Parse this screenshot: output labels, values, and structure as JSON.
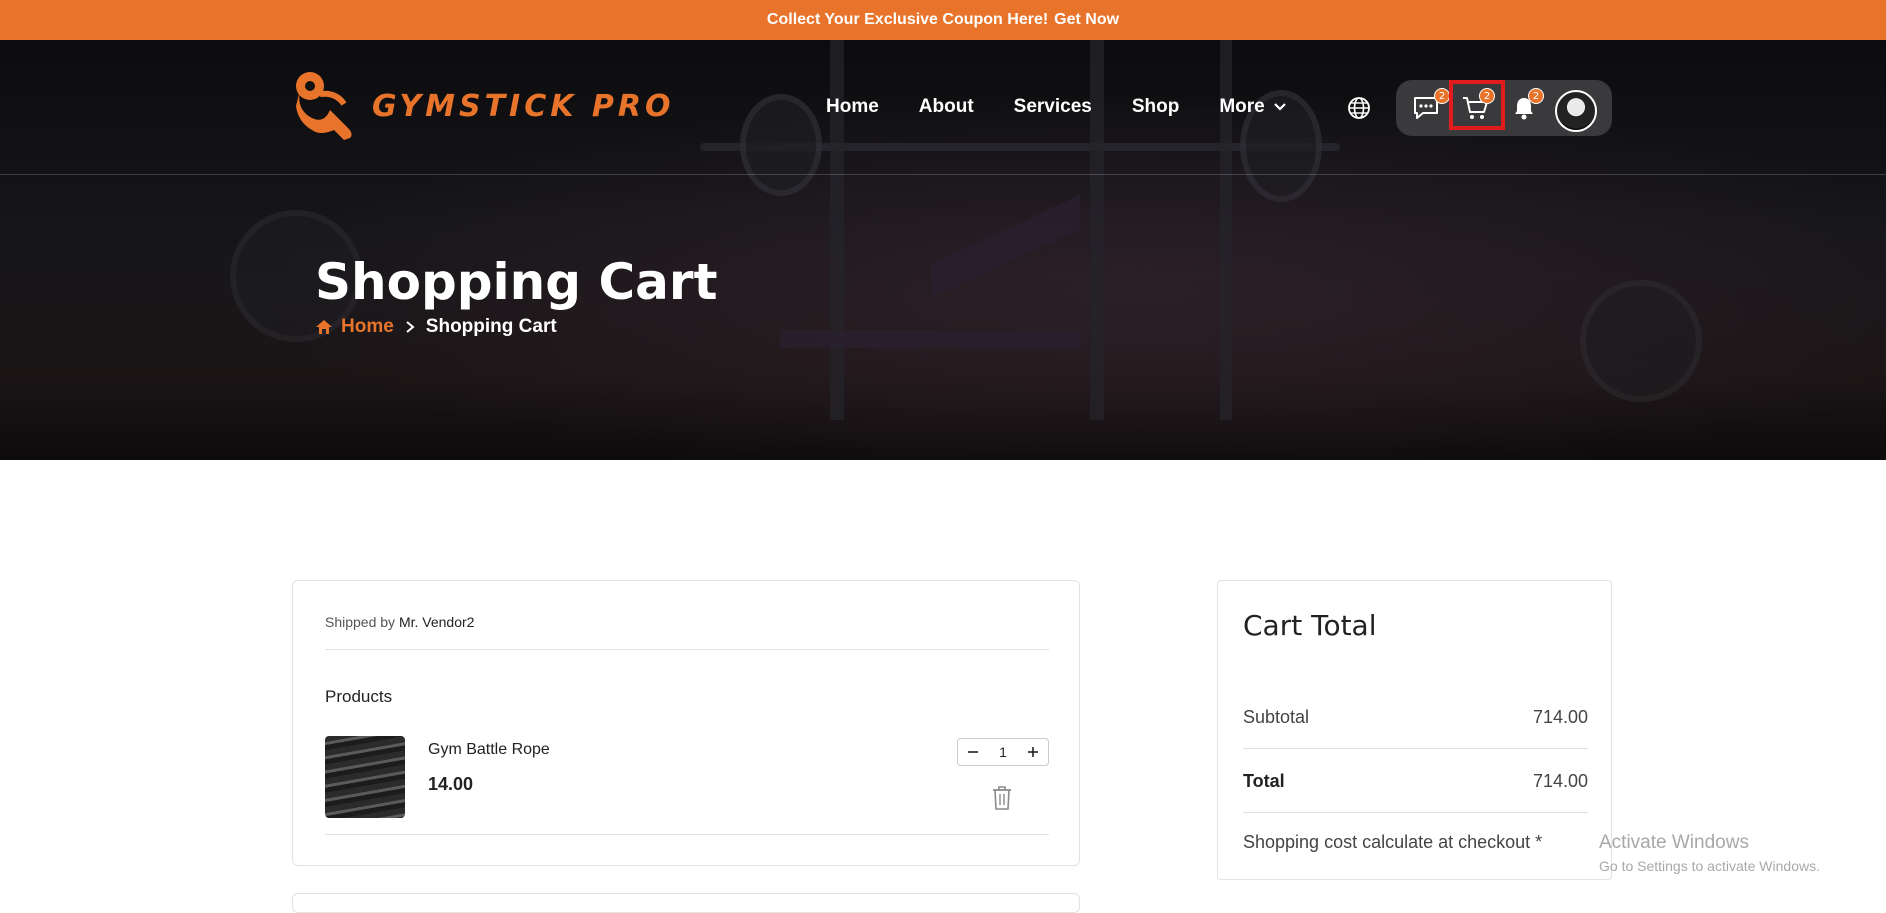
{
  "promo": {
    "text": "Collect Your Exclusive Coupon Here!",
    "cta": "Get Now"
  },
  "brand": {
    "name": "GYMSTICK PRO",
    "accent": "#e8742b"
  },
  "nav": {
    "home": "Home",
    "about": "About",
    "services": "Services",
    "shop": "Shop",
    "more": "More"
  },
  "header_actions": {
    "messages_count": "2",
    "cart_count": "2",
    "notifications_count": "2"
  },
  "hero": {
    "title": "Shopping Cart"
  },
  "breadcrumb": {
    "home": "Home",
    "current": "Shopping Cart"
  },
  "cart": {
    "shipped_prefix": "Shipped by",
    "vendor": "Mr. Vendor2",
    "products_label": "Products",
    "items": [
      {
        "name": "Gym Battle Rope",
        "price": "14.00",
        "quantity": "1"
      }
    ]
  },
  "cart_total": {
    "title": "Cart Total",
    "subtotal_label": "Subtotal",
    "subtotal_value": "714.00",
    "total_label": "Total",
    "total_value": "714.00",
    "shipping_note": "Shopping cost calculate at checkout *"
  },
  "watermark": {
    "line1": "Activate Windows",
    "line2": "Go to Settings to activate Windows."
  }
}
